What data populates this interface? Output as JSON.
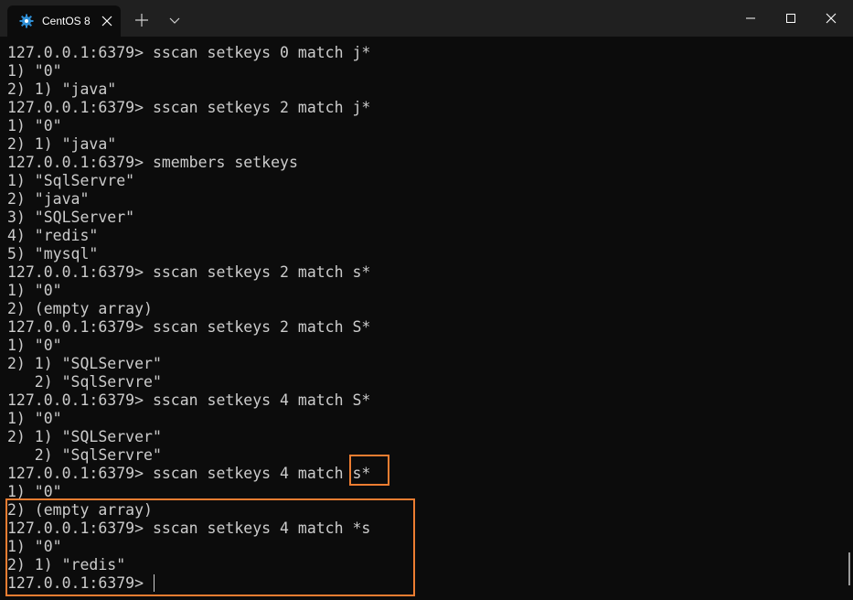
{
  "window": {
    "tab_title": "CentOS 8",
    "icons": {
      "tab": "centos-gear-icon",
      "tab_close": "close-icon",
      "new_tab": "plus-icon",
      "dropdown": "chevron-down-icon",
      "minimize": "minimize-icon",
      "maximize": "maximize-icon",
      "close": "close-icon"
    }
  },
  "terminal": {
    "lines": [
      "127.0.0.1:6379> sscan setkeys 0 match j*",
      "1) \"0\"",
      "2) 1) \"java\"",
      "127.0.0.1:6379> sscan setkeys 2 match j*",
      "1) \"0\"",
      "2) 1) \"java\"",
      "127.0.0.1:6379> smembers setkeys",
      "1) \"SqlServre\"",
      "2) \"java\"",
      "3) \"SQLServer\"",
      "4) \"redis\"",
      "5) \"mysql\"",
      "127.0.0.1:6379> sscan setkeys 2 match s*",
      "1) \"0\"",
      "2) (empty array)",
      "127.0.0.1:6379> sscan setkeys 2 match S*",
      "1) \"0\"",
      "2) 1) \"SQLServer\"",
      "   2) \"SqlServre\"",
      "127.0.0.1:6379> sscan setkeys 4 match S*",
      "1) \"0\"",
      "2) 1) \"SQLServer\"",
      "   2) \"SqlServre\"",
      "127.0.0.1:6379> sscan setkeys 4 match s*",
      "1) \"0\"",
      "2) (empty array)",
      "127.0.0.1:6379> sscan setkeys 4 match *s",
      "1) \"0\"",
      "2) 1) \"redis\"",
      "127.0.0.1:6379> "
    ]
  },
  "colors": {
    "background": "#0c0c0c",
    "titlebar": "#202020",
    "text": "#cccccc",
    "highlight": "#ed7d31",
    "centos_icon": "#2f8fd6"
  }
}
